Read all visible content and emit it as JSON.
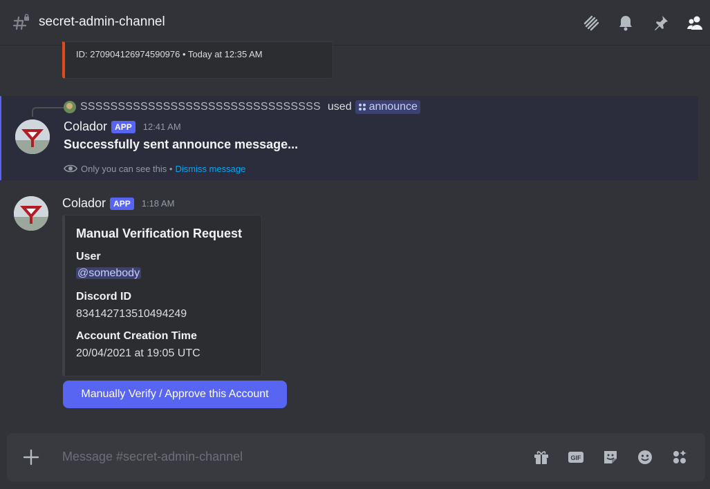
{
  "header": {
    "channel_name": "secret-admin-channel",
    "icons": [
      "channel-hash-lock-icon",
      "threads-icon",
      "bell-icon",
      "pin-icon",
      "members-icon"
    ]
  },
  "previous_embed": {
    "footer": "ID: 270904126974590976 • Today at 12:35 AM"
  },
  "ephemeral_message": {
    "reply": {
      "username": "SSSSSSSSSSSSSSSSSSSSSSSSSSSSSSSS",
      "used": "used",
      "command": "announce"
    },
    "author": "Colador",
    "tag": "APP",
    "time": "12:41 AM",
    "content": "Successfully sent announce message...",
    "only_you": "Only you can see this •",
    "dismiss": "Dismiss message"
  },
  "verification_message": {
    "author": "Colador",
    "tag": "APP",
    "time": "1:18 AM",
    "embed": {
      "title": "Manual Verification Request",
      "fields": [
        {
          "name": "User",
          "value": "@somebody"
        },
        {
          "name": "Discord ID",
          "value": "834142713510494249"
        },
        {
          "name": "Account Creation Time",
          "value": "20/04/2021 at 19:05 UTC"
        }
      ]
    },
    "button_label": "Manually Verify / Approve this Account"
  },
  "composer": {
    "placeholder": "Message #secret-admin-channel",
    "icons": [
      "plus-icon",
      "gift-icon",
      "gif-icon",
      "sticker-icon",
      "emoji-icon",
      "apps-icon"
    ]
  },
  "colors": {
    "background": "#323339",
    "accent": "#5865f2",
    "prev_embed_border": "#e34a1b",
    "link": "#00a8fc"
  }
}
